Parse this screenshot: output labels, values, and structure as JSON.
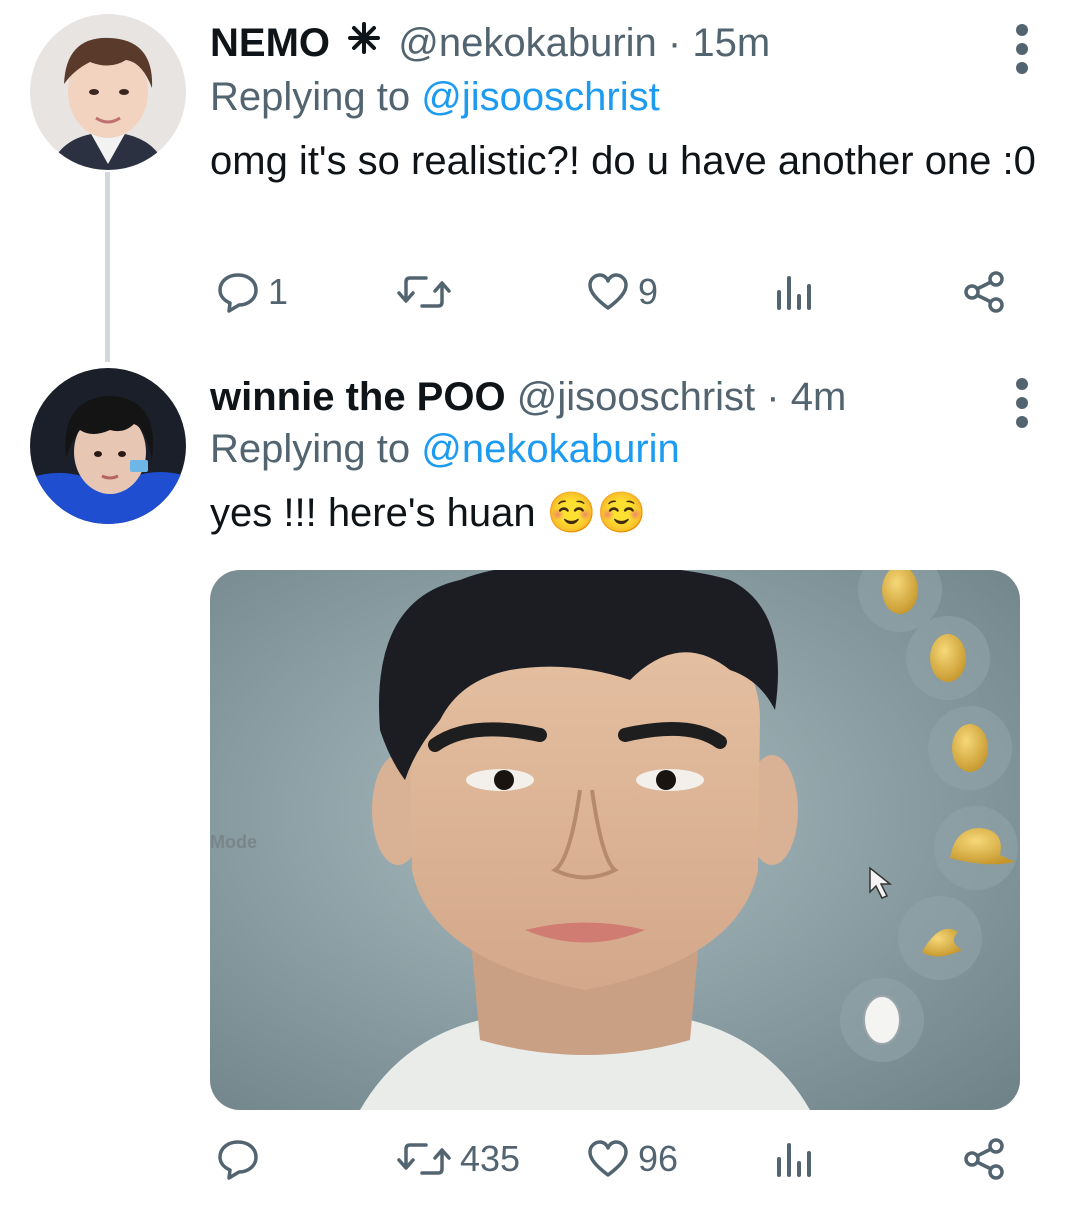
{
  "tweets": [
    {
      "display_name": "NEMO",
      "handle": "@nekokaburin",
      "time": "· 15m",
      "reply_prefix": "Replying to",
      "reply_handle": "@jisooschrist",
      "text": "omg it's so realistic?! do u have another one :0",
      "actions": {
        "replies": "1",
        "retweets": "",
        "likes": "9"
      }
    },
    {
      "display_name": "winnie the POO",
      "handle": "@jisooschrist",
      "time": "· 4m",
      "reply_prefix": "Replying to",
      "reply_handle": "@nekokaburin",
      "text": "yes !!! here's huan ☺️☺️",
      "media_overlay_text": "Mode",
      "actions": {
        "replies": "",
        "retweets": "435",
        "likes": "96"
      }
    }
  ],
  "icons": [
    "reply-icon",
    "retweet-icon",
    "like-icon",
    "analytics-icon",
    "share-icon",
    "more-icon",
    "sparkle-badge-icon"
  ],
  "colors": {
    "text": "#0f1419",
    "secondary": "#536471",
    "link": "#1d9bf0",
    "thread_line": "#cfd9de"
  }
}
